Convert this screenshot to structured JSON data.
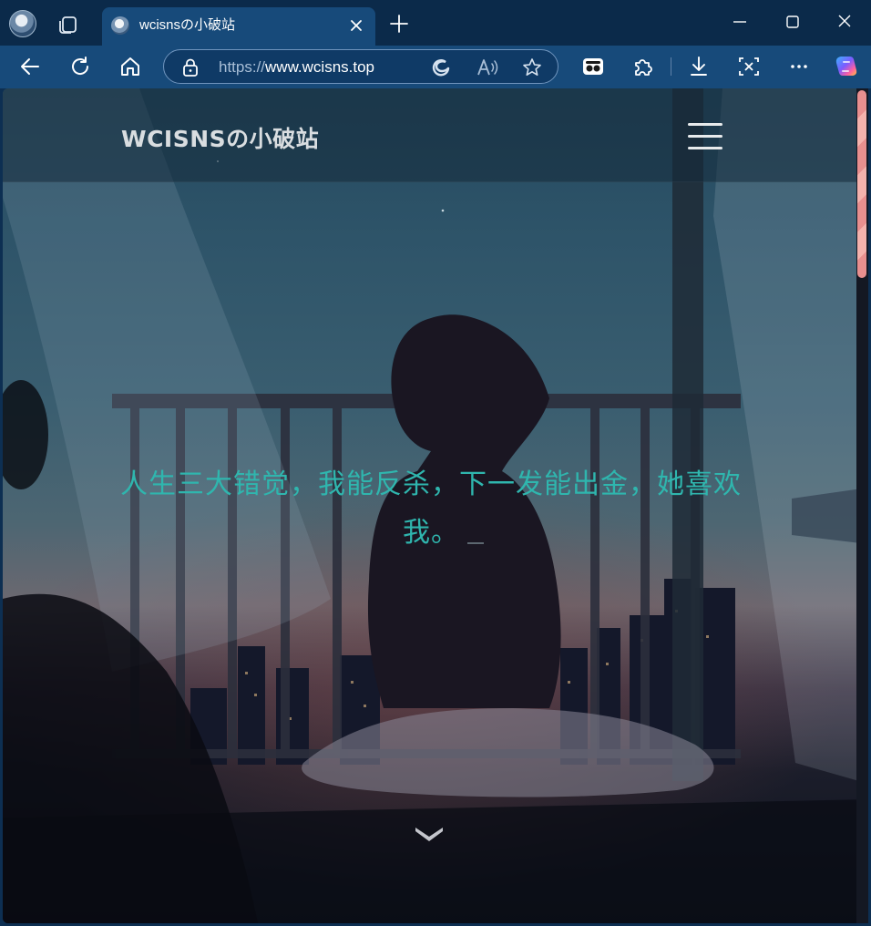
{
  "browser": {
    "tab": {
      "title": "wcisnsの小破站"
    },
    "address": {
      "scheme": "https://",
      "host": "www.wcisns.top"
    },
    "icons": {
      "profile": "profile-avatar-icon",
      "tabs": "tab-actions-icon",
      "new_tab": "plus-icon",
      "back": "back-arrow-icon",
      "refresh": "refresh-icon",
      "home": "home-icon",
      "site_info": "lock-icon",
      "edge": "edge-icon",
      "read_aloud": "read-aloud-icon",
      "favorite": "star-icon",
      "immersive_reader": "immersive-reader-icon",
      "extensions": "puzzle-icon",
      "downloads": "download-icon",
      "screenshot": "screenshot-icon",
      "more": "more-icon",
      "copilot": "copilot-icon"
    }
  },
  "page": {
    "site_title": "WCISNSの小破站",
    "hero_text": "人生三大错觉，我能反杀，下一发能出金，她喜欢我。"
  },
  "colors": {
    "tab_bar": "#0b2a4a",
    "toolbar": "#174a7a",
    "hero_text": "#2fb6ae",
    "scroll_thumb": "#e88f8f"
  }
}
